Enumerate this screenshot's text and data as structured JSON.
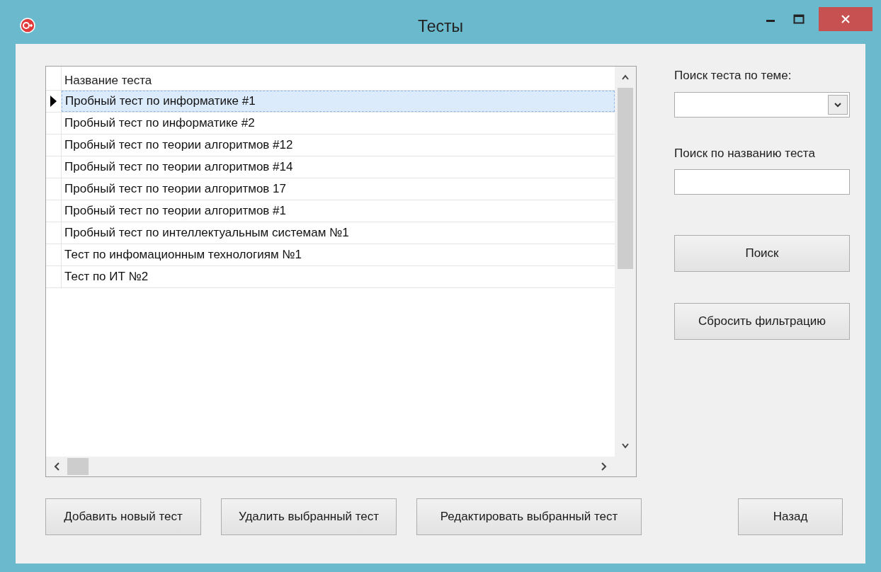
{
  "window": {
    "title": "Тесты"
  },
  "table": {
    "columns": [
      "Название теста"
    ],
    "rows": [
      {
        "name": "Пробный тест по информатике #1",
        "selected": true
      },
      {
        "name": "Пробный тест по информатике #2",
        "selected": false
      },
      {
        "name": "Пробный тест по теории алгоритмов #12",
        "selected": false
      },
      {
        "name": "Пробный тест по теории алгоритмов #14",
        "selected": false
      },
      {
        "name": "Пробный тест по теории алгоритмов 17",
        "selected": false
      },
      {
        "name": "Пробный тест по теории алгоритмов #1",
        "selected": false
      },
      {
        "name": "Пробный тест по интеллектуальным системам №1",
        "selected": false
      },
      {
        "name": "Тест по инфомационным технологиям №1",
        "selected": false
      },
      {
        "name": "Тест по ИТ №2",
        "selected": false
      }
    ]
  },
  "filters": {
    "topic_label": "Поиск теста по теме:",
    "name_label": "Поиск по названию теста",
    "search_button": "Поиск",
    "reset_button": "Сбросить фильтрацию"
  },
  "buttons": [
    "Добавить новый тест",
    "Удалить выбранный тест",
    "Редактировать выбранный тест"
  ],
  "back_button": "Назад"
}
